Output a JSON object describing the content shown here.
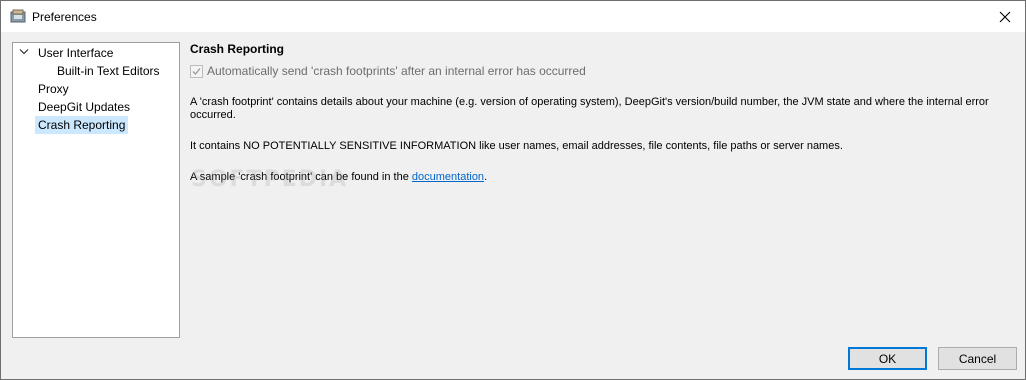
{
  "window": {
    "title": "Preferences"
  },
  "icons": {
    "app": "app-icon",
    "close": "close-icon",
    "expand": "chevron-down-icon"
  },
  "tree": {
    "items": [
      {
        "label": "User Interface"
      },
      {
        "label": "Built-in Text Editors"
      },
      {
        "label": "Proxy"
      },
      {
        "label": "DeepGit Updates"
      },
      {
        "label": "Crash Reporting"
      }
    ],
    "selected": "Crash Reporting"
  },
  "page": {
    "title": "Crash Reporting",
    "checkbox": {
      "label": "Automatically send 'crash footprints' after an internal error has occurred",
      "checked": true,
      "disabled": true
    },
    "para1": "A 'crash footprint' contains details about your machine (e.g. version of operating system), DeepGit's version/build number, the JVM state and where the internal error occurred.",
    "para2": "It contains NO POTENTIALLY SENSITIVE INFORMATION like user names, email addresses, file contents, file paths or server names.",
    "para3_prefix": "A sample 'crash footprint' can be found in the ",
    "para3_link": "documentation",
    "para3_suffix": "."
  },
  "buttons": {
    "ok": "OK",
    "cancel": "Cancel"
  },
  "colors": {
    "selection": "#cce8ff",
    "link": "#0066cc",
    "default_button_border": "#0078d7"
  },
  "watermark": "SOFTPEDIA"
}
